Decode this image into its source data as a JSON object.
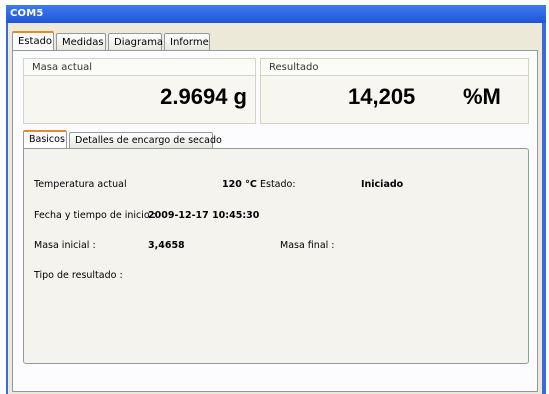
{
  "window": {
    "title": "COM5"
  },
  "main_tabs": [
    "Estado",
    "Medidas",
    "Diagrama",
    "Informe"
  ],
  "masa_actual": {
    "label": "Masa actual",
    "value": "2.9694 g"
  },
  "resultado": {
    "label": "Resultado",
    "value": "14,205",
    "unit": "%M"
  },
  "inner_tabs": [
    "Basicos",
    "Detalles de encargo de secado"
  ],
  "basicos": {
    "temp_label": "Temperatura actual",
    "temp_value": "120 °C",
    "estado_label": "Estado:",
    "estado_value": "Iniciado",
    "fecha_label": "Fecha y tiempo de inicio :",
    "fecha_value": "2009-12-17 10:45:30",
    "masa_inicial_label": "Masa inicial :",
    "masa_inicial_value": "3,4658",
    "masa_final_label": "Masa final :",
    "tipo_label": "Tipo de resultado :"
  }
}
